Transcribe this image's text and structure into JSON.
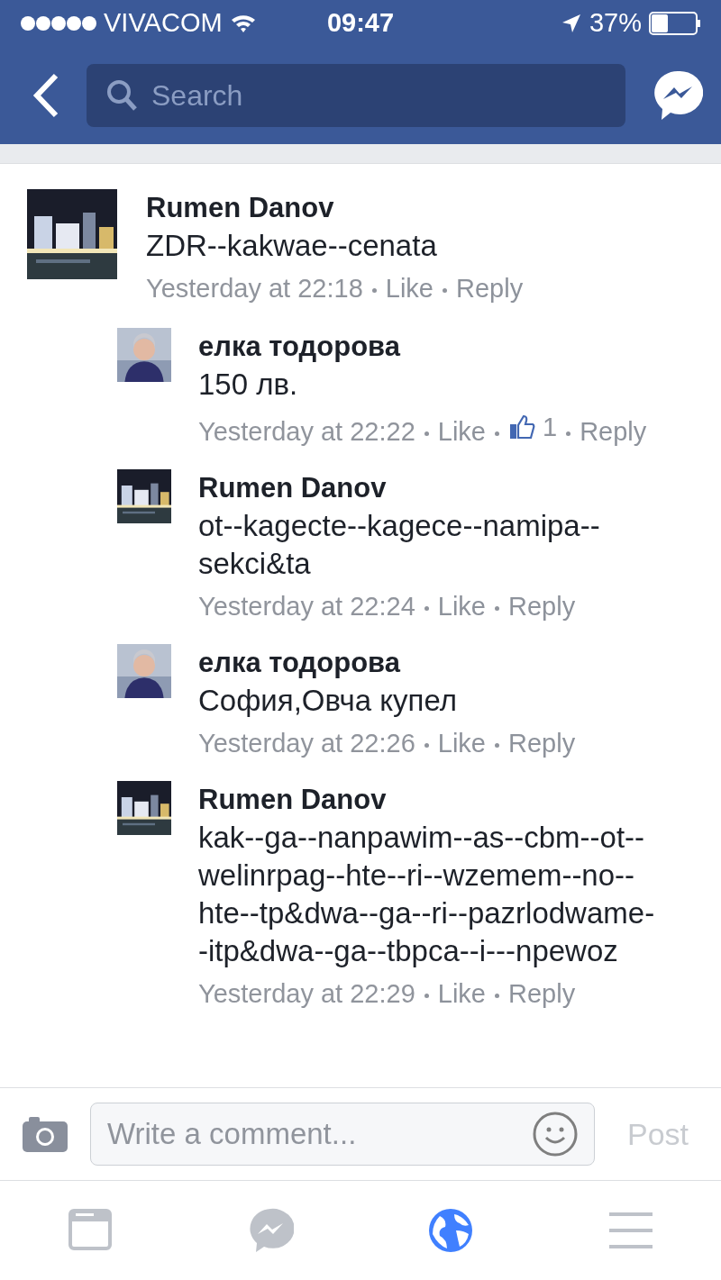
{
  "status_bar": {
    "carrier": "VIVACOM",
    "time": "09:47",
    "battery": "37%"
  },
  "nav": {
    "search": {
      "placeholder": "Search"
    }
  },
  "comments": [
    {
      "author": "Rumen Danov",
      "text": "ZDR--kakwae--cenata",
      "meta": {
        "time": "Yesterday at 22:18",
        "actions": [
          {
            "kind": "link",
            "text": "Like"
          },
          {
            "kind": "link",
            "text": "Reply"
          }
        ]
      },
      "children": [
        {
          "author": "елка тодорова",
          "text": "150 лв.",
          "meta": {
            "time": "Yesterday at 22:22",
            "actions": [
              {
                "kind": "link",
                "text": "Like"
              },
              {
                "kind": "likes",
                "text": "1"
              },
              {
                "kind": "link",
                "text": "Reply"
              }
            ]
          }
        },
        {
          "author": "Rumen Danov",
          "text": "ot--kagecte--kagece--namipa--sekci&ta",
          "meta": {
            "time": "Yesterday at 22:24",
            "actions": [
              {
                "kind": "link",
                "text": "Like"
              },
              {
                "kind": "link",
                "text": "Reply"
              }
            ]
          }
        },
        {
          "author": "елка тодорова",
          "text": "София,Овча купел",
          "meta": {
            "time": "Yesterday at 22:26",
            "actions": [
              {
                "kind": "link",
                "text": "Like"
              },
              {
                "kind": "link",
                "text": "Reply"
              }
            ]
          }
        },
        {
          "author": "Rumen Danov",
          "text": "kak--ga--nanpawim--as--cbm--ot--welinrpag--hte--ri--wzemem--no--hte--tp&dwa--ga--ri--pazrlodwame--itp&dwa--ga--tbpca--i---npewoz",
          "meta": {
            "time": "Yesterday at 22:29",
            "actions": [
              {
                "kind": "link",
                "text": "Like"
              },
              {
                "kind": "link",
                "text": "Reply"
              }
            ]
          }
        }
      ]
    }
  ],
  "composer": {
    "placeholder": "Write a comment...",
    "post": "Post",
    "post_disabled": true
  },
  "tab_bar": [
    {
      "kind": "feed",
      "selected": false
    },
    {
      "kind": "messenger",
      "selected": false
    },
    {
      "kind": "globe",
      "selected": true
    },
    {
      "kind": "menu",
      "selected": false
    }
  ]
}
